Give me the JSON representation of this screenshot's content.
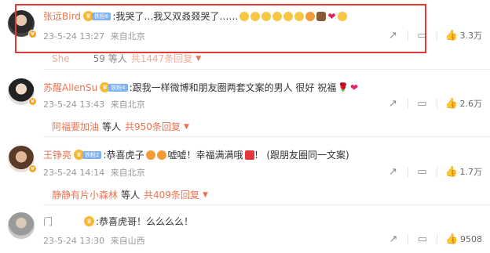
{
  "comments": [
    {
      "username": "张远Bird",
      "fan_level": "铁粉6",
      "text": ":我哭了…我又双叒叕哭了……",
      "timestamp": "23-5-24 13:27",
      "location": "来自北京",
      "likes": "3.3万",
      "reply_preview": {
        "name": "She",
        "suffix": "59 等人",
        "count_label": "共1447条回复"
      }
    },
    {
      "username": "苏醒AllenSu",
      "fan_level": "铁粉4",
      "text": ":跟我一样微博和朋友圈两套文案的男人 很好 祝福",
      "timestamp": "23-5-24 13:43",
      "location": "来自北京",
      "likes": "2.6万",
      "reply_preview": {
        "name": "阿福要加油",
        "suffix": "等人",
        "count_label": "共950条回复"
      }
    },
    {
      "username": "王铮亮",
      "fan_level": "铁粉2",
      "text_parts": [
        ":恭喜虎子",
        "嘘嘘！幸福满满哦",
        "！ (跟朋友圈同一文案)"
      ],
      "timestamp": "23-5-24 14:14",
      "location": "来自北京",
      "likes": "1.7万",
      "reply_preview": {
        "name": "静静有片小森林",
        "suffix": "等人",
        "count_label": "共409条回复"
      }
    },
    {
      "username": "门",
      "text": ":恭喜虎哥！么么么么！",
      "timestamp": "23-5-24 13:30",
      "location": "来自山西",
      "likes": "9508"
    }
  ],
  "icons": {
    "share": "share-icon",
    "comment": "comment-icon",
    "like": "thumbs-up-icon",
    "verified": "verified-badge-icon"
  },
  "colors": {
    "username": "#eb7350",
    "highlight_border": "#e13a36",
    "meta_text": "#999999"
  }
}
